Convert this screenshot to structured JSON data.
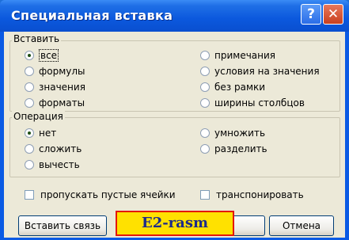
{
  "window": {
    "title": "Специальная вставка",
    "help_label": "?",
    "close_label": "✕"
  },
  "paste_group": {
    "label": "Вставить",
    "options": [
      "все",
      "формулы",
      "значения",
      "форматы",
      "примечания",
      "условия на значения",
      "без рамки",
      "ширины столбцов"
    ],
    "selected": "все"
  },
  "operation_group": {
    "label": "Операция",
    "options": [
      "нет",
      "сложить",
      "вычесть",
      "умножить",
      "разделить"
    ],
    "selected": "нет"
  },
  "checkboxes": {
    "skip_blanks": "пропускать пустые ячейки",
    "transpose": "транспонировать"
  },
  "buttons": {
    "paste_link": "Вставить связь",
    "ok": "",
    "cancel": "Отмена"
  },
  "overlay_label": "E2-rasm"
}
